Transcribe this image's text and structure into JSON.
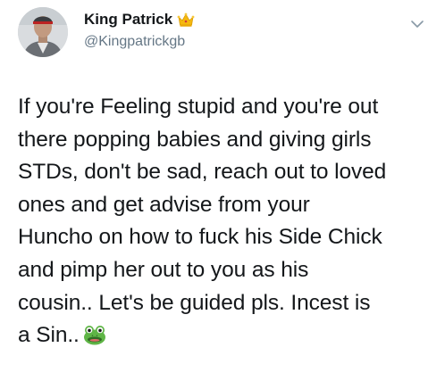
{
  "tweet": {
    "author": {
      "display_name": "King Patrick",
      "handle": "@Kingpatrickgb",
      "name_badge_icon": "crown-icon",
      "avatar": "avatar-photo"
    },
    "menu_icon": "chevron-down-icon",
    "text": "If you're Feeling stupid and you're out\nthere popping babies and giving girls\nSTDs, don't be sad, reach out to loved\nones and get advise from your\nHuncho on how to fuck his Side Chick\nand pimp her out to you as his\ncousin.. Let's be guided pls. Incest is\na Sin..",
    "trailing_emoji": "frog-face-icon",
    "colors": {
      "text": "#14171a",
      "handle": "#657786",
      "crown": "#f5b90f",
      "frog": "#5fb546"
    }
  }
}
